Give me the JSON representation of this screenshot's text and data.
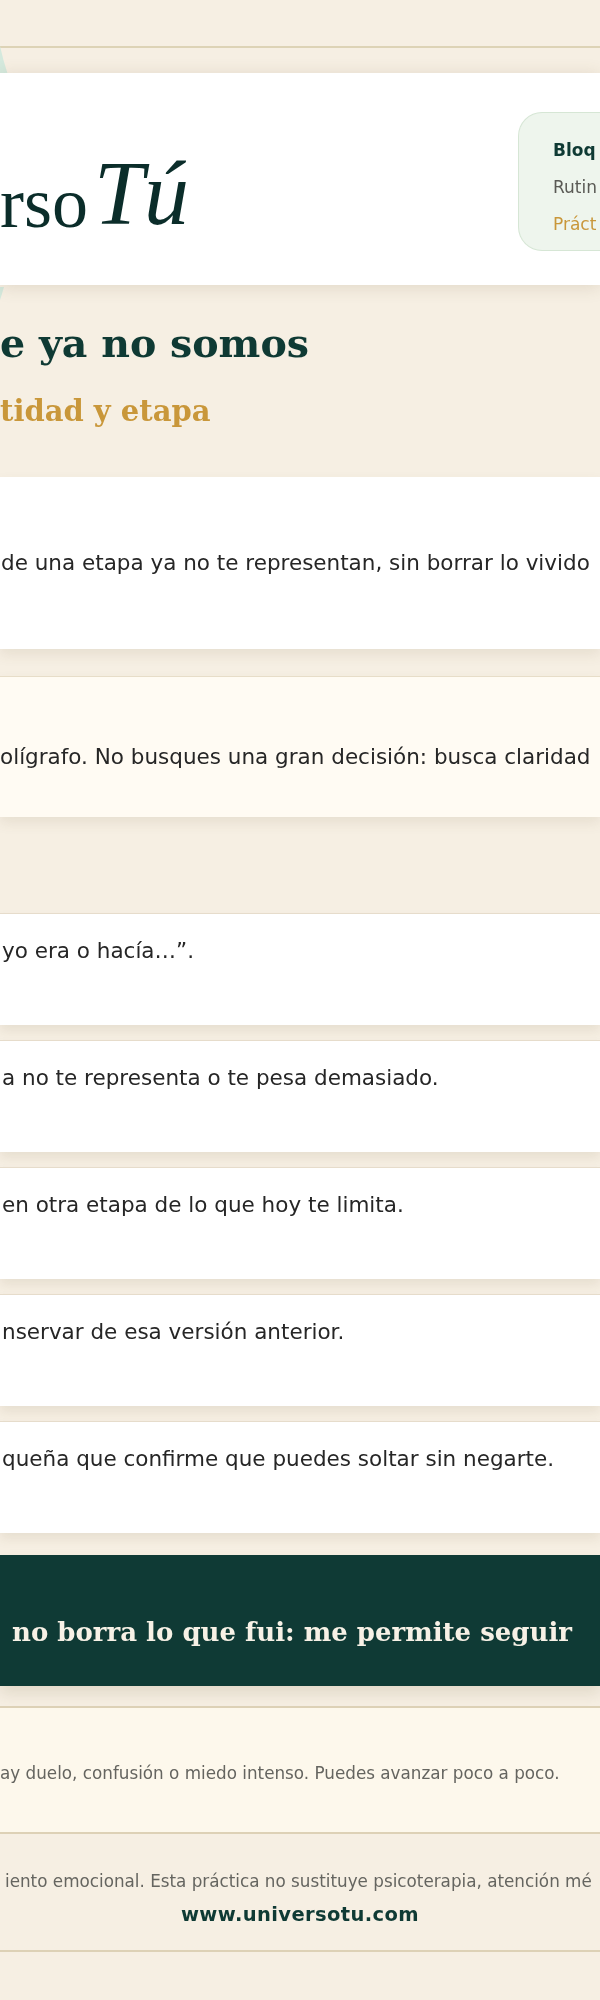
{
  "header": {
    "logo": {
      "serif_text": "rso",
      "script_text": "Tú"
    },
    "info_card": {
      "lines": [
        {
          "kind": "title",
          "text": "Bloq"
        },
        {
          "kind": "subtitle",
          "text": "Rutin"
        },
        {
          "kind": "tag",
          "text": "Práct"
        }
      ]
    }
  },
  "title": "e ya no somos",
  "subtitle": "tidad y etapa",
  "intro_card": {
    "text": "de una etapa ya no te representan, sin borrar lo vivido"
  },
  "tip_card": {
    "text": "olígrafo. No busques una gran decisión: busca claridad"
  },
  "steps": [
    {
      "text": "yo era o hacía…”."
    },
    {
      "text": "a no te representa o te pesa demasiado."
    },
    {
      "text": "en otra etapa de lo que hoy te limita."
    },
    {
      "text": "nservar de esa versión anterior."
    },
    {
      "text": "queña que confirme que puedes soltar sin negarte."
    }
  ],
  "quote_banner": {
    "text": "no borra lo que fui: me permite seguir"
  },
  "note": {
    "text": "ay duelo, confusión o miedo intenso. Puedes avanzar poco a poco."
  },
  "footer": {
    "disclaimer": "iento emocional. Esta práctica no sustituye psicoterapia, atención mé",
    "website": "www.universotu.com"
  }
}
